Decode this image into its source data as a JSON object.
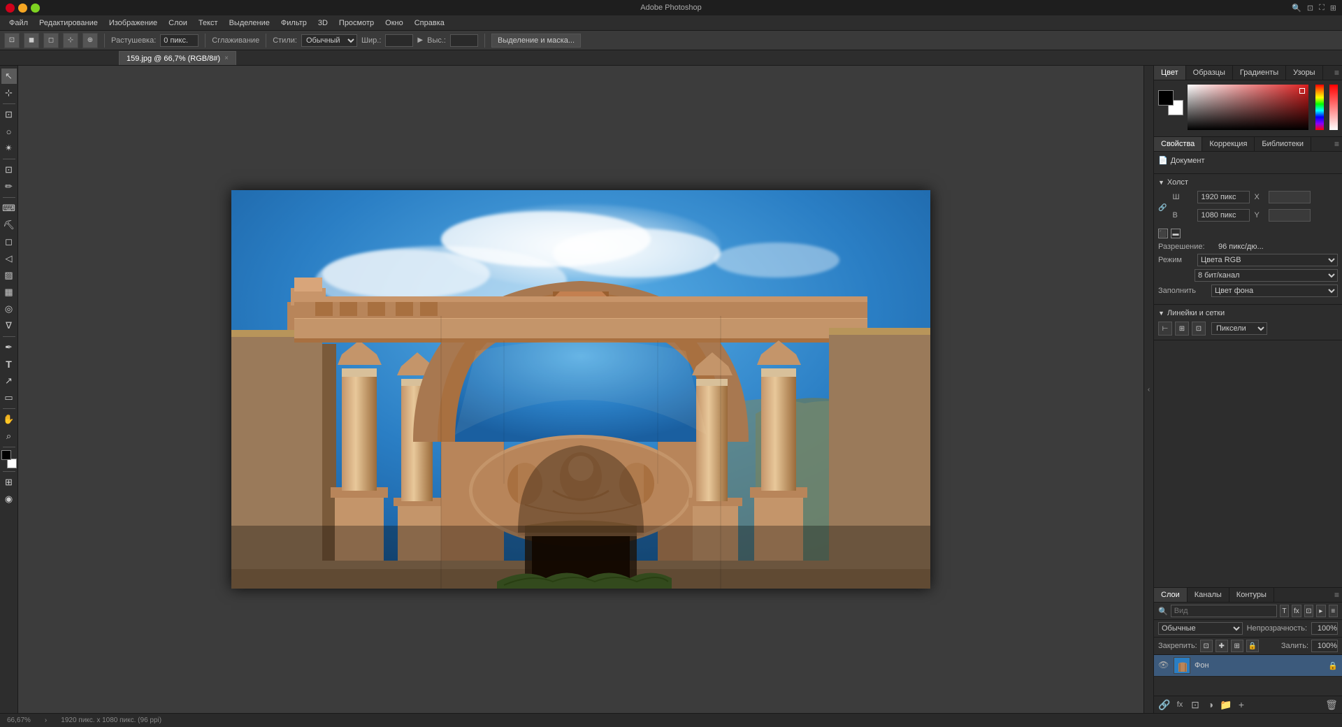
{
  "titlebar": {
    "title": "Adobe Photoshop",
    "minimize": "−",
    "maximize": "□",
    "close": "×"
  },
  "menubar": {
    "items": [
      "Файл",
      "Редактирование",
      "Изображение",
      "Слои",
      "Текст",
      "Выделение",
      "Фильтр",
      "3D",
      "Просмотр",
      "Окно",
      "Справка"
    ]
  },
  "optionsbar": {
    "rastushevka_label": "Растушевка:",
    "rastushevka_value": "0 пикс.",
    "sglazhivanie_label": "Сглаживание",
    "stili_label": "Стили:",
    "stili_value": "Обычный",
    "shirina_label": "Шир.:",
    "vysota_label": "Выс.:",
    "selection_mask_button": "Выделение и маска..."
  },
  "tabbar": {
    "tab_name": "159.jpg @ 66,7% (RGB/8#)",
    "close": "×"
  },
  "tools": {
    "items": [
      "↖",
      "⊹",
      "○",
      "⊡",
      "✂",
      "✏",
      "⌨",
      "⛏",
      "◻",
      "◁",
      "🖊",
      "🖌",
      "S",
      "∇",
      "≡",
      "⌛",
      "☁",
      "⬛",
      "⊞",
      "◉",
      "⌕",
      "✋"
    ]
  },
  "colorpanel": {
    "tabs": [
      "Цвет",
      "Образцы",
      "Градиенты",
      "Узоры"
    ],
    "active_tab": "Цвет"
  },
  "properties": {
    "tabs": [
      "Свойства",
      "Коррекция",
      "Библиотеки"
    ],
    "active_tab": "Свойства",
    "sections": {
      "document": {
        "label": "Документ"
      },
      "canvas": {
        "label": "Холст",
        "width_label": "Ш",
        "width_value": "1920 пикс",
        "x_label": "X",
        "x_value": "",
        "height_label": "В",
        "height_value": "1080 пикс",
        "y_label": "Y",
        "y_value": "",
        "razreshenie_label": "Разрешение:",
        "razreshenie_value": "96 пикс/дю...",
        "rezhim_label": "Режим",
        "rezhim_value": "Цвета RGB",
        "bit_label": "8 бит/канал",
        "zapolnit_label": "Заполнить",
        "zapolnit_value": "Цвет фона"
      },
      "grids": {
        "label": "Линейки и сетки",
        "unit_value": "Пиксели"
      }
    }
  },
  "layers": {
    "tabs": [
      "Слои",
      "Каналы",
      "Контуры"
    ],
    "active_tab": "Слои",
    "search_placeholder": "Вид",
    "mode_value": "Обычные",
    "opacity_label": "Непрозрачность:",
    "opacity_value": "100%",
    "lock_label": "Закрепить:",
    "fill_label": "Залить:",
    "fill_value": "100%",
    "items": [
      {
        "name": "Фон",
        "visible": true,
        "locked": true
      }
    ]
  },
  "statusbar": {
    "zoom": "66,67%",
    "dimensions": "1920 пикс. x 1080 пикс. (96 ppi)",
    "info": "›"
  }
}
